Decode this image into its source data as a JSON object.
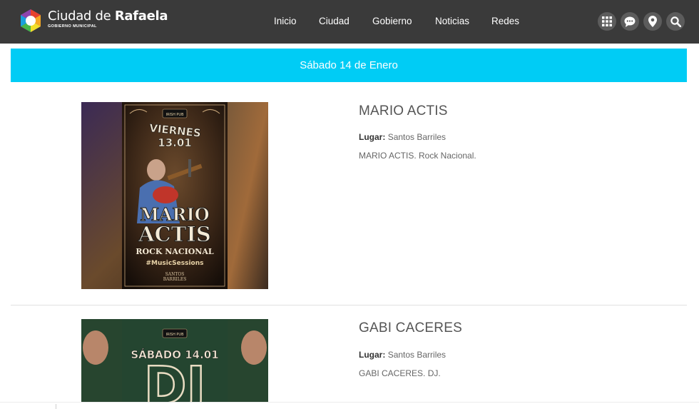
{
  "header": {
    "logo_city": "Ciudad de",
    "logo_name": "Rafaela",
    "logo_subtitle": "GOBIERNO MUNICIPAL",
    "nav": [
      "Inicio",
      "Ciudad",
      "Gobierno",
      "Noticias",
      "Redes"
    ],
    "icons": [
      "grid-icon",
      "chat-icon",
      "location-pin-icon",
      "search-icon"
    ],
    "bar_color": "#3a3a3a"
  },
  "date_banner": {
    "text": "Sábado 14 de Enero",
    "color": "#00ccf5"
  },
  "events": [
    {
      "title": "MARIO ACTIS",
      "place_label": "Lugar:",
      "place": "Santos Barriles",
      "description": "MARIO ACTIS. Rock Nacional.",
      "poster": {
        "badge": "IRISH PUB",
        "day": "VIERNES",
        "date": "13.01",
        "name_line1": "MARIO",
        "name_line2": "ACTIS",
        "genre": "ROCK NACIONAL",
        "hashtag": "#MusicSessions",
        "brand_line1": "SANTOS",
        "brand_line2": "BARRILES"
      }
    },
    {
      "title": "GABI CACERES",
      "place_label": "Lugar:",
      "place": "Santos Barriles",
      "description": "GABI CACERES. DJ.",
      "poster": {
        "badge": "IRISH PUB",
        "day_date": "SÁBADO 14.01",
        "big": "DJ"
      }
    }
  ]
}
